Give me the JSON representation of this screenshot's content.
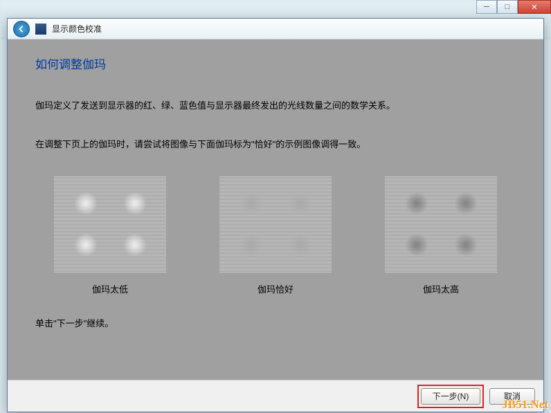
{
  "window": {
    "title": "显示颜色校准"
  },
  "page": {
    "title": "如何调整伽玛",
    "desc1": "伽玛定义了发送到显示器的红、绿、蓝色值与显示器最终发出的光线数量之间的数学关系。",
    "desc2": "在调整下页上的伽玛时，请尝试将图像与下面伽玛标为\"恰好\"的示例图像调得一致。",
    "continue": "单击\"下一步\"继续。"
  },
  "samples": {
    "low": "伽玛太低",
    "good": "伽玛恰好",
    "high": "伽玛太高"
  },
  "buttons": {
    "next": "下一步(N)",
    "cancel": "取消"
  },
  "watermark": "JB51.Net"
}
